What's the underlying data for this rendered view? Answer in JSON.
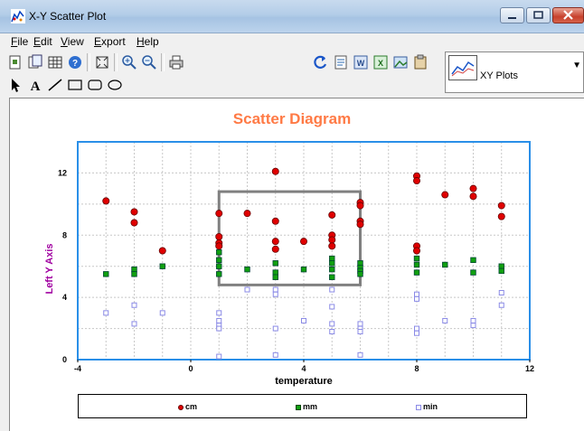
{
  "window": {
    "title": "X-Y Scatter Plot"
  },
  "menu": {
    "items": [
      {
        "label": "File",
        "acc": "F",
        "rest": "ile"
      },
      {
        "label": "Edit",
        "acc": "E",
        "rest": "dit"
      },
      {
        "label": "View",
        "acc": "V",
        "rest": "iew"
      },
      {
        "label": "Export",
        "acc": "E",
        "rest": "xport"
      },
      {
        "label": "Help",
        "acc": "H",
        "rest": "elp"
      }
    ]
  },
  "toolbar": {
    "plot_selector": "XY Plots",
    "line_width_value": "1"
  },
  "colors": {
    "title": "#ff7a45",
    "frame": "#2a8fe8",
    "cm": "#e00000",
    "mm": "#10a010",
    "min": "#8a8ae6",
    "yaxis_label": "#a000a0"
  },
  "chart_data": {
    "type": "scatter",
    "title": "Scatter Diagram",
    "xlabel": "temperature",
    "ylabel": "Left Y Axis",
    "xlim": [
      -4,
      12
    ],
    "ylim": [
      0,
      14
    ],
    "xticks": [
      "-4",
      "0",
      "4",
      "8",
      "12"
    ],
    "yticks": [
      "0",
      "4",
      "8",
      "12"
    ],
    "grid": true,
    "legend_position": "bottom",
    "series": [
      {
        "name": "cm",
        "marker": "circle",
        "color": "#e00000",
        "points": [
          [
            -3,
            10.2
          ],
          [
            -2,
            9.5
          ],
          [
            -2,
            8.8
          ],
          [
            -1,
            7
          ],
          [
            1,
            9.4
          ],
          [
            1,
            7.9
          ],
          [
            1,
            7.5
          ],
          [
            1,
            7.3
          ],
          [
            2,
            9.4
          ],
          [
            3,
            12.1
          ],
          [
            3,
            8.9
          ],
          [
            3,
            7.6
          ],
          [
            3,
            7.1
          ],
          [
            4,
            7.6
          ],
          [
            5,
            9.3
          ],
          [
            5,
            8
          ],
          [
            5,
            7.7
          ],
          [
            5,
            7.3
          ],
          [
            6,
            10.1
          ],
          [
            6,
            9.9
          ],
          [
            6,
            8.9
          ],
          [
            6,
            8.7
          ],
          [
            8,
            11.8
          ],
          [
            8,
            11.5
          ],
          [
            8,
            7.3
          ],
          [
            8,
            7
          ],
          [
            9,
            10.6
          ],
          [
            10,
            11
          ],
          [
            10,
            10.5
          ],
          [
            11,
            9.9
          ],
          [
            11,
            9.2
          ]
        ]
      },
      {
        "name": "mm",
        "marker": "square",
        "color": "#10a010",
        "points": [
          [
            -3,
            5.5
          ],
          [
            -2,
            5.8
          ],
          [
            -2,
            5.5
          ],
          [
            -1,
            6
          ],
          [
            1,
            6.9
          ],
          [
            1,
            6.4
          ],
          [
            1,
            6
          ],
          [
            1,
            5.5
          ],
          [
            2,
            5.8
          ],
          [
            3,
            6.2
          ],
          [
            3,
            5.6
          ],
          [
            3,
            5.3
          ],
          [
            4,
            5.8
          ],
          [
            5,
            6.5
          ],
          [
            5,
            6.2
          ],
          [
            5,
            5.8
          ],
          [
            5,
            5.3
          ],
          [
            6,
            6.2
          ],
          [
            6,
            5.9
          ],
          [
            6,
            5.7
          ],
          [
            6,
            5.5
          ],
          [
            8,
            6.5
          ],
          [
            8,
            6.1
          ],
          [
            8,
            5.6
          ],
          [
            9,
            6.1
          ],
          [
            10,
            6.4
          ],
          [
            10,
            5.6
          ],
          [
            11,
            6
          ],
          [
            11,
            5.7
          ]
        ]
      },
      {
        "name": "min",
        "marker": "square-open",
        "color": "#8a8ae6",
        "points": [
          [
            -3,
            3
          ],
          [
            -2,
            3.5
          ],
          [
            -2,
            2.3
          ],
          [
            -1,
            3
          ],
          [
            1,
            3
          ],
          [
            1,
            2.5
          ],
          [
            1,
            2.2
          ],
          [
            1,
            2
          ],
          [
            1,
            0.2
          ],
          [
            2,
            4.5
          ],
          [
            3,
            4.5
          ],
          [
            3,
            4.2
          ],
          [
            3,
            2
          ],
          [
            3,
            0.3
          ],
          [
            4,
            2.5
          ],
          [
            5,
            4.5
          ],
          [
            5,
            3.4
          ],
          [
            5,
            2.3
          ],
          [
            5,
            1.8
          ],
          [
            6,
            2.3
          ],
          [
            6,
            2
          ],
          [
            6,
            1.8
          ],
          [
            6,
            0.3
          ],
          [
            8,
            4.2
          ],
          [
            8,
            3.9
          ],
          [
            8,
            2
          ],
          [
            8,
            1.7
          ],
          [
            9,
            2.5
          ],
          [
            10,
            2.5
          ],
          [
            10,
            2.2
          ],
          [
            11,
            4.3
          ],
          [
            11,
            3.5
          ]
        ]
      }
    ],
    "annotations": [
      {
        "type": "rectangle",
        "x": [
          1,
          6
        ],
        "y": [
          4.8,
          10.8
        ]
      }
    ]
  }
}
